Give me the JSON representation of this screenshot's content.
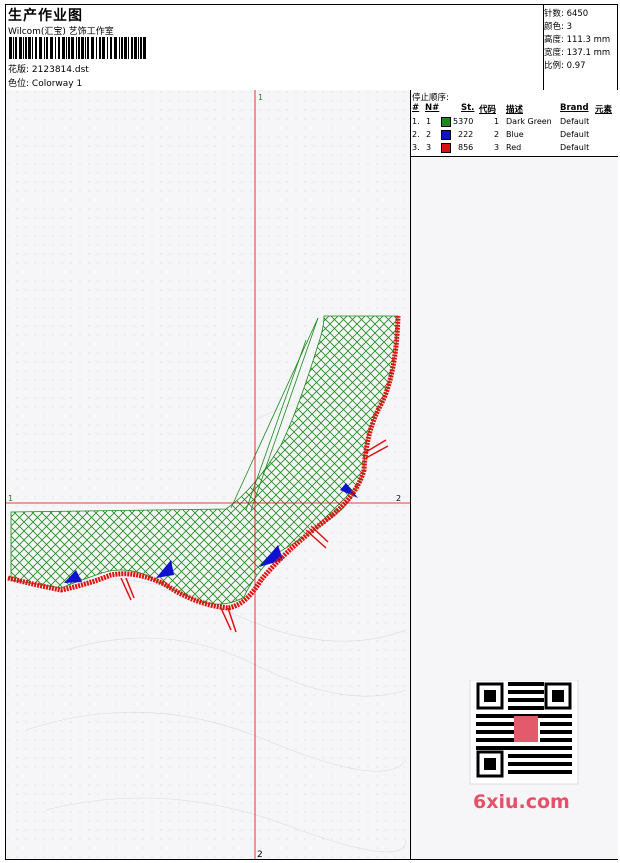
{
  "header": {
    "title": "生产作业图",
    "studio": "Wilcom(汇宝) 艺饰工作室",
    "design_label": "花版:",
    "design_file": "2123814.dst",
    "color_label": "色位:",
    "colorway": "Colorway 1"
  },
  "stats": [
    {
      "label": "针数:",
      "value": "6450"
    },
    {
      "label": "颜色:",
      "value": "3"
    },
    {
      "label": "高度:",
      "value": "111.3 mm"
    },
    {
      "label": "宽度:",
      "value": "137.1 mm"
    },
    {
      "label": "比例:",
      "value": "0.97"
    }
  ],
  "stop_sequence": {
    "title": "停止顺序:",
    "headers": [
      "#",
      "N#",
      "St.",
      "代码",
      "描述",
      "Brand",
      "元素"
    ],
    "rows": [
      {
        "num": "1.",
        "n": "1",
        "color": "#1a8a1a",
        "stitches": "5370",
        "code": "1",
        "desc": "Dark Green",
        "brand": "Default"
      },
      {
        "num": "2.",
        "n": "2",
        "color": "#1010d0",
        "stitches": "222",
        "code": "2",
        "desc": "Blue",
        "brand": "Default"
      },
      {
        "num": "3.",
        "n": "3",
        "color": "#e01010",
        "stitches": "856",
        "code": "3",
        "desc": "Red",
        "brand": "Default"
      }
    ]
  },
  "markers": {
    "top": "1",
    "bottom": "2",
    "left": "1",
    "right": "2"
  },
  "watermark": {
    "site": "6xiu.com"
  },
  "colors": {
    "guide": "#e00000",
    "green": "#1a8a1a",
    "blue": "#1010d0",
    "red": "#e01010"
  }
}
